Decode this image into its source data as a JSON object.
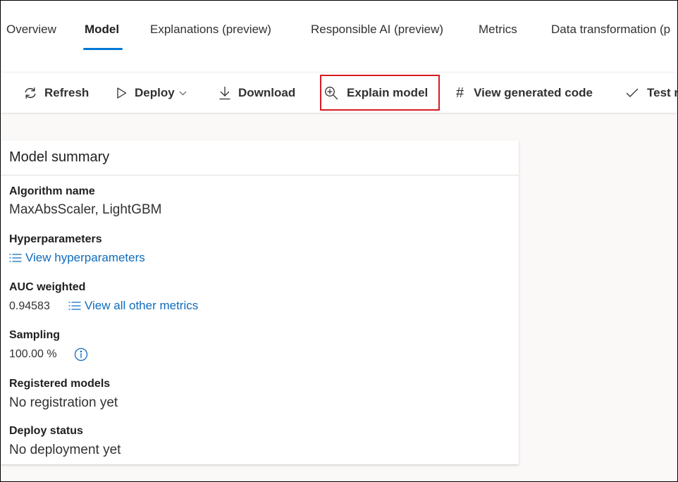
{
  "tabs": [
    {
      "label": "Overview"
    },
    {
      "label": "Model"
    },
    {
      "label": "Explanations (preview)"
    },
    {
      "label": "Responsible AI (preview)"
    },
    {
      "label": "Metrics"
    },
    {
      "label": "Data transformation (p"
    }
  ],
  "active_tab": "Model",
  "toolbar": {
    "refresh_label": "Refresh",
    "deploy_label": "Deploy",
    "download_label": "Download",
    "explain_label": "Explain model",
    "view_code_label": "View generated code",
    "test_label": "Test n"
  },
  "summary": {
    "title": "Model summary",
    "algorithm_label": "Algorithm name",
    "algorithm_value": "MaxAbsScaler, LightGBM",
    "hyper_label": "Hyperparameters",
    "hyper_link": "View hyperparameters",
    "auc_label": "AUC weighted",
    "auc_value": "0.94583",
    "metrics_link": "View all other metrics",
    "sampling_label": "Sampling",
    "sampling_value": "100.00 %",
    "registered_label": "Registered models",
    "registered_value": "No registration yet",
    "deploy_status_label": "Deploy status",
    "deploy_status_value": "No deployment yet"
  },
  "colors": {
    "accent": "#0078d4",
    "link": "#0f6cbd",
    "highlight": "#d41c24"
  },
  "icons": [
    "refresh-icon",
    "play-icon",
    "chevron-down-icon",
    "download-icon",
    "zoom-in-icon",
    "hash-icon",
    "checkmark-icon",
    "list-icon",
    "info-icon"
  ]
}
